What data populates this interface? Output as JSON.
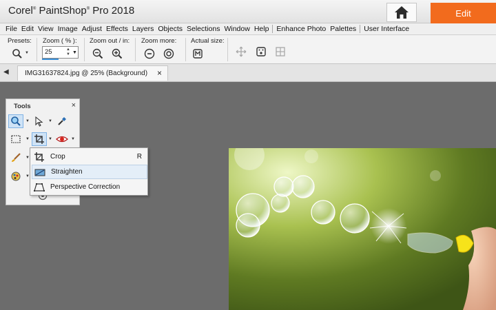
{
  "titlebar": {
    "app_name": "Corel",
    "app_name_2": "PaintShop",
    "app_name_3": "Pro 2018",
    "edit_label": "Edit"
  },
  "menu": {
    "items": [
      "File",
      "Edit",
      "View",
      "Image",
      "Adjust",
      "Effects",
      "Layers",
      "Objects",
      "Selections",
      "Window",
      "Help"
    ],
    "extra_items": [
      "Enhance Photo",
      "Palettes"
    ],
    "last_item": "User Interface"
  },
  "options": {
    "presets_label": "Presets:",
    "zoom_label": "Zoom ( % ):",
    "zoom_value": "25",
    "zoom_inout_label": "Zoom out / in:",
    "zoom_more_label": "Zoom more:",
    "actual_size_label": "Actual size:"
  },
  "tab": {
    "filename": "IMG31637824.jpg",
    "info": "@ 25% (Background)",
    "close": "×"
  },
  "tools": {
    "title": "Tools",
    "close": "×"
  },
  "flyout": {
    "items": [
      {
        "label": "Crop",
        "shortcut": "R"
      },
      {
        "label": "Straighten",
        "shortcut": ""
      },
      {
        "label": "Perspective Correction",
        "shortcut": ""
      }
    ]
  },
  "colors": {
    "accent": "#f26b1d",
    "selection": "#3a8fd8",
    "workspace": "#6c6c6c"
  }
}
